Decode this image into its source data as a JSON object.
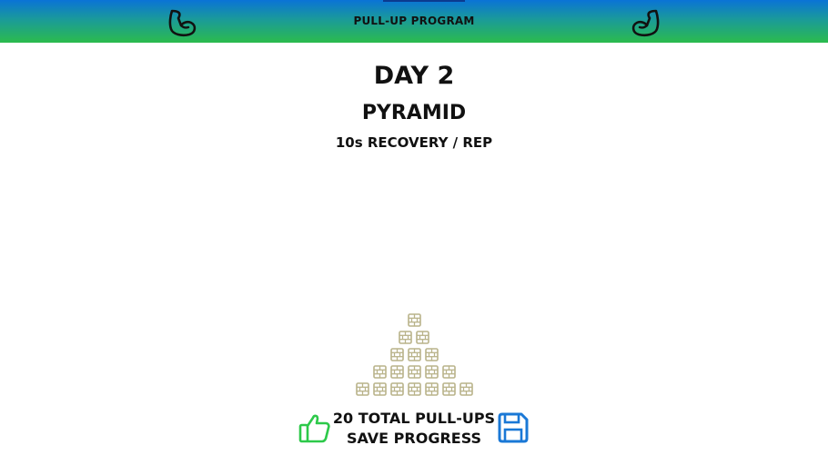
{
  "header": {
    "title": "PULL-UP PROGRAM",
    "left_icon": "flexed-bicep-icon",
    "right_icon": "flexed-bicep-icon",
    "gradient_colors": [
      "#0a73d6",
      "#2bbb4c"
    ]
  },
  "workout": {
    "day": "DAY 2",
    "name": "PYRAMID",
    "recovery": "10s RECOVERY / REP"
  },
  "pyramid": {
    "sets_per_row_top_to_bottom": [
      1,
      2,
      3,
      5,
      7
    ],
    "brick_icon": "brick-wall-icon",
    "brick_color": "#b9b38a"
  },
  "footer": {
    "total": "20 TOTAL PULL-UPS",
    "save_label": "SAVE PROGRESS",
    "thumbs_icon": "thumbs-up-icon",
    "thumbs_color": "#2dc94a",
    "save_icon": "floppy-disk-icon",
    "save_color": "#1a78d6"
  }
}
